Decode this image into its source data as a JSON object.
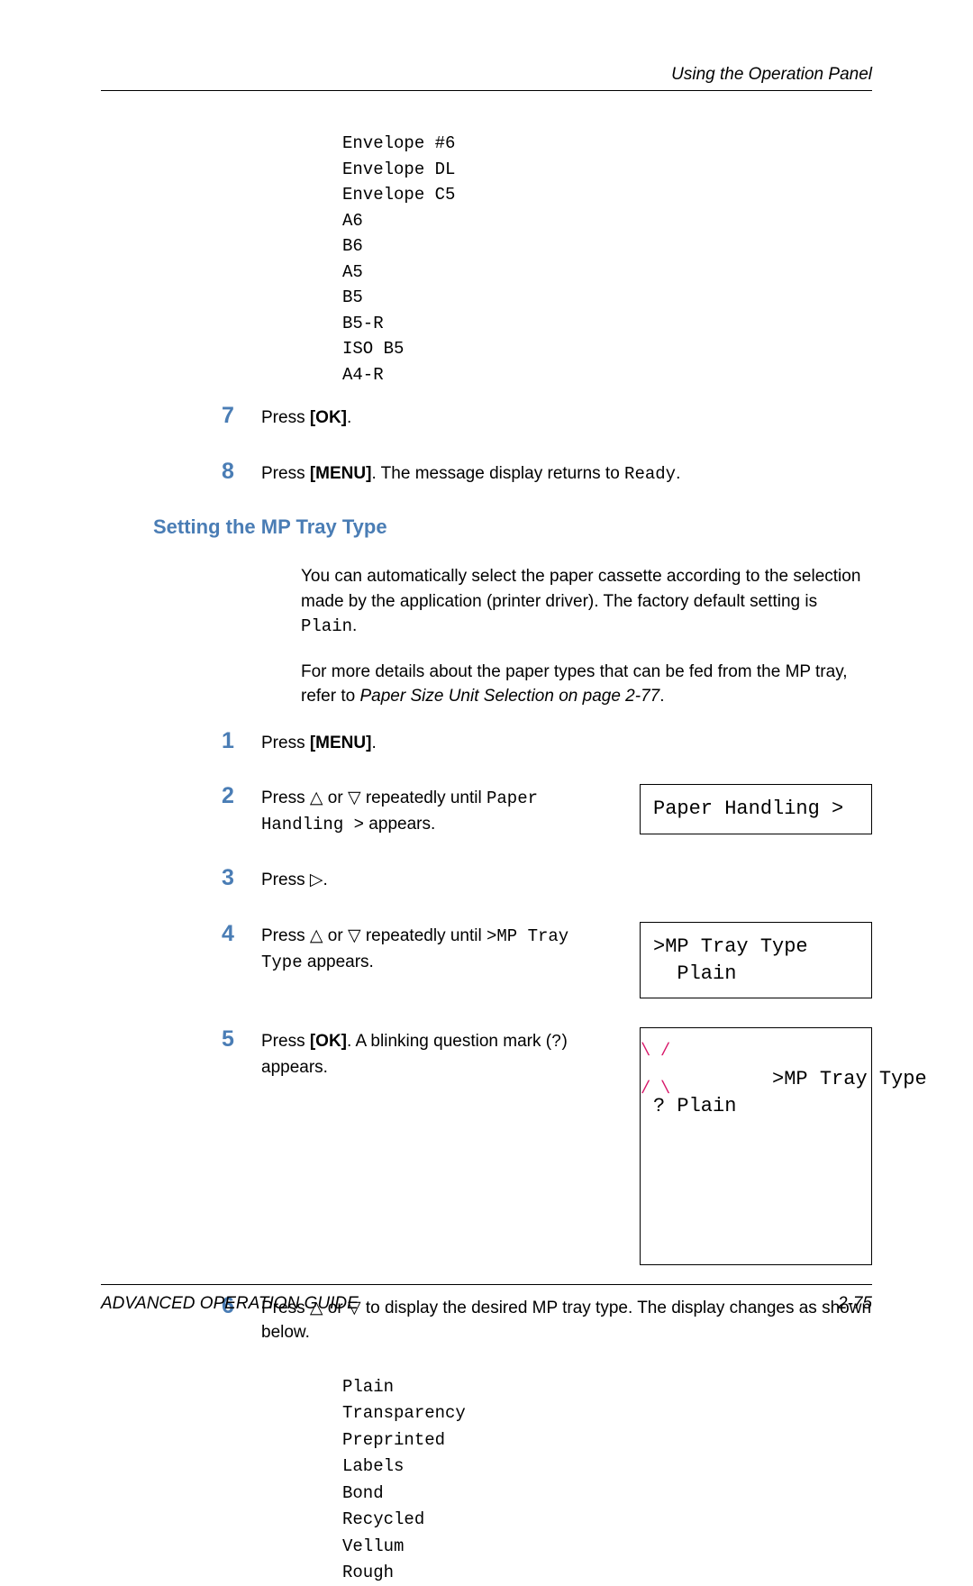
{
  "header": {
    "title": "Using the Operation Panel"
  },
  "sizes": [
    "Envelope #6",
    "Envelope DL",
    "Envelope C5",
    "A6",
    "B6",
    "A5",
    "B5",
    "B5-R",
    "ISO B5",
    "A4-R"
  ],
  "step7": {
    "num": "7",
    "press": "Press ",
    "ok": "[OK]",
    "dot": "."
  },
  "step8": {
    "num": "8",
    "press": "Press ",
    "menu": "[MENU]",
    "middle": ". The message display returns to ",
    "ready": "Ready",
    "dot": "."
  },
  "section_heading": "Setting the MP Tray Type",
  "intro1": {
    "a": "You can automatically select the paper cassette according to the selection made by the application (printer driver). The factory default setting is ",
    "b": "Plain",
    "c": "."
  },
  "intro2": {
    "a": "For more details about the paper types that can be fed from the MP tray, refer to ",
    "b": "Paper Size Unit Selection on page 2-77",
    "c": "."
  },
  "s1": {
    "num": "1",
    "press": "Press ",
    "menu": "[MENU]",
    "dot": "."
  },
  "s2": {
    "num": "2",
    "a": "Press ",
    "b": " or ",
    "c": " repeatedly until ",
    "d": "Paper Handling >",
    "e": " appears.",
    "display": "Paper Handling >"
  },
  "s3": {
    "num": "3",
    "a": "Press ",
    "b": "."
  },
  "s4": {
    "num": "4",
    "a": "Press ",
    "b": " or ",
    "c": " repeatedly until ",
    "d": ">MP Tray Type",
    "e": " appears.",
    "display": ">MP Tray Type\n  Plain"
  },
  "s5": {
    "num": "5",
    "a": "Press ",
    "ok": "[OK]",
    "b": ". A blinking question mark (",
    "q": "?",
    "c": ") appears.",
    "display": ">MP Tray Type\n? Plain"
  },
  "s6": {
    "num": "6",
    "a": "Press ",
    "b": " or ",
    "c": " to display the desired MP tray type. The display changes as shown below."
  },
  "types": [
    "Plain",
    "Transparency",
    "Preprinted",
    "Labels",
    "Bond",
    "Recycled",
    "Vellum",
    "Rough"
  ],
  "footer": {
    "left": "ADVANCED OPERATION GUIDE",
    "right": "2-75"
  },
  "tri": {
    "up": "△",
    "down": "▽",
    "right": "▷"
  }
}
